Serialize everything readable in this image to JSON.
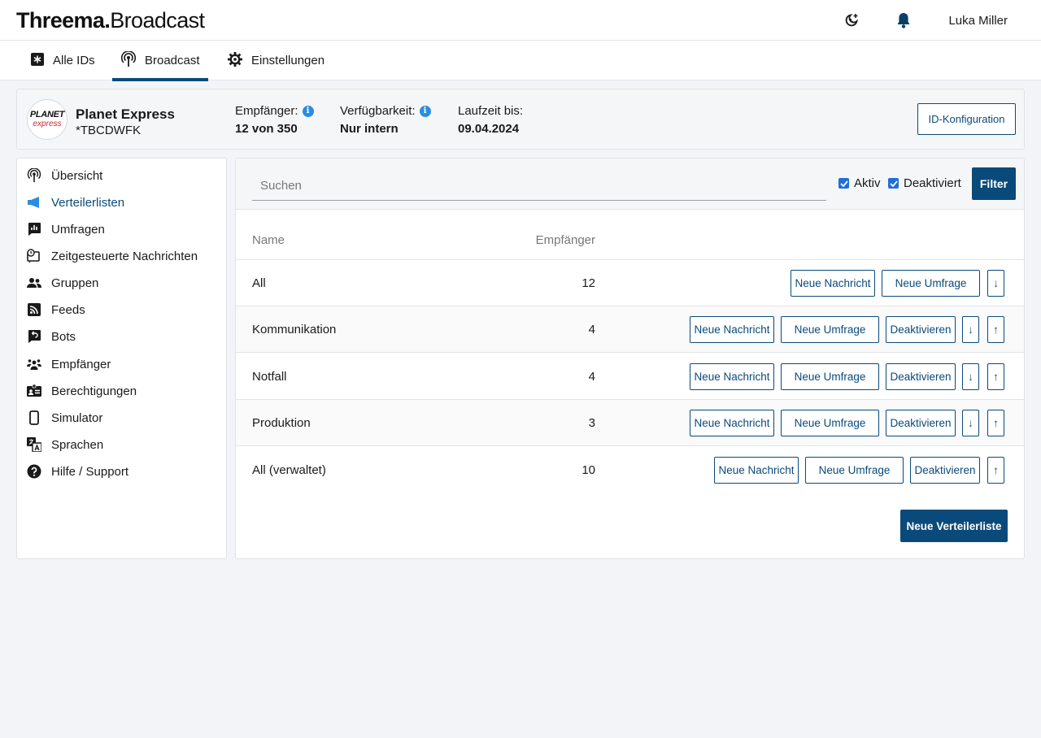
{
  "header": {
    "logo_bold": "Threema.",
    "logo_regular": "Broadcast",
    "user_name": "Luka Miller"
  },
  "tabs": [
    {
      "label": "Alle IDs",
      "icon": "id-badge-icon"
    },
    {
      "label": "Broadcast",
      "icon": "broadcast-icon",
      "active": true
    },
    {
      "label": "Einstellungen",
      "icon": "gear-icon"
    }
  ],
  "org": {
    "logo_line1": "PLANET",
    "logo_line2": "express",
    "name": "Planet Express",
    "id": "*TBCDWFK",
    "recipients_label": "Empfänger:",
    "recipients_value": "12 von 350",
    "availability_label": "Verfügbarkeit:",
    "availability_value": "Nur intern",
    "runtime_label": "Laufzeit bis:",
    "runtime_value": "09.04.2024",
    "config_button": "ID-Konfiguration"
  },
  "sidebar": {
    "items": [
      {
        "label": "Übersicht",
        "icon": "broadcast-icon"
      },
      {
        "label": "Verteilerlisten",
        "icon": "megaphone-icon",
        "active": true
      },
      {
        "label": "Umfragen",
        "icon": "poll-icon"
      },
      {
        "label": "Zeitgesteuerte Nachrichten",
        "icon": "scheduled-message-icon"
      },
      {
        "label": "Gruppen",
        "icon": "group-icon"
      },
      {
        "label": "Feeds",
        "icon": "rss-icon"
      },
      {
        "label": "Bots",
        "icon": "bot-reply-icon"
      },
      {
        "label": "Empfänger",
        "icon": "recipients-icon"
      },
      {
        "label": "Berechtigungen",
        "icon": "id-card-icon"
      },
      {
        "label": "Simulator",
        "icon": "phone-icon"
      },
      {
        "label": "Sprachen",
        "icon": "translate-icon"
      },
      {
        "label": "Hilfe / Support",
        "icon": "help-icon"
      }
    ]
  },
  "search": {
    "placeholder": "Suchen",
    "filter_active": "Aktiv",
    "filter_inactive": "Deaktiviert",
    "filter_button": "Filter"
  },
  "table": {
    "col_name": "Name",
    "col_recipients": "Empfänger",
    "btn_new_message": "Neue Nachricht",
    "btn_new_poll": "Neue Umfrage",
    "btn_deactivate": "Deaktivieren",
    "arrow_down": "↓",
    "arrow_up": "↑",
    "rows": [
      {
        "name": "All",
        "count": "12"
      },
      {
        "name": "Kommunikation",
        "count": "4"
      },
      {
        "name": "Notfall",
        "count": "4"
      },
      {
        "name": "Produktion",
        "count": "3"
      },
      {
        "name": "All (verwaltet)",
        "count": "10"
      }
    ]
  },
  "new_list_button": "Neue Verteilerliste",
  "colors": {
    "primary": "#0a4a7a",
    "info": "#2a8de0",
    "checkbox": "#1f6fd6",
    "background": "#f2f4f8"
  }
}
